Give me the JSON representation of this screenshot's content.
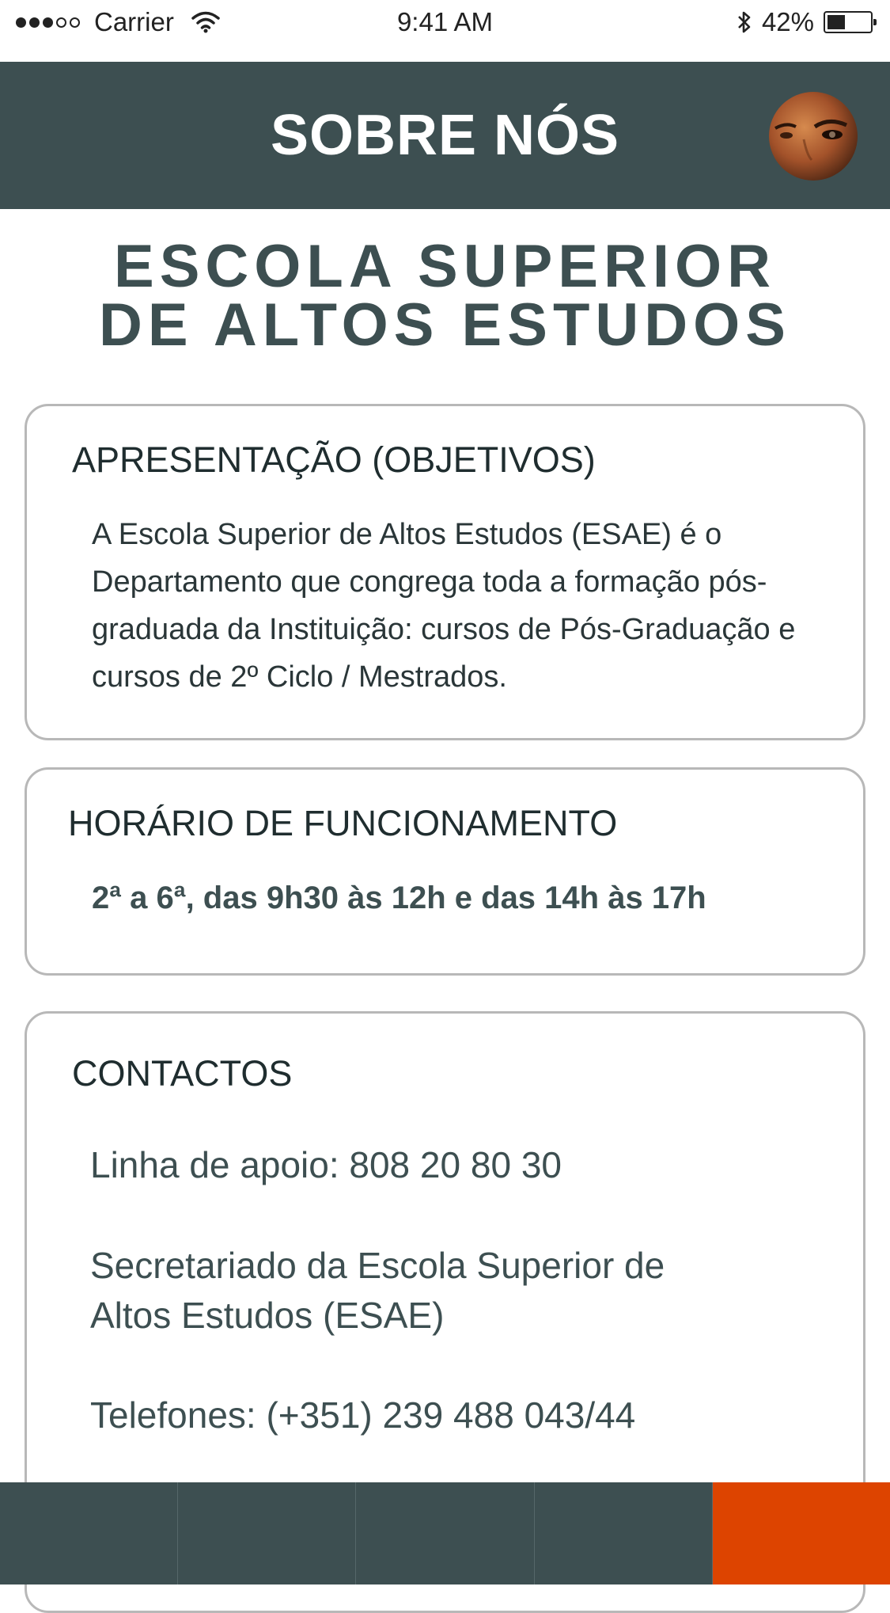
{
  "status_bar": {
    "carrier": "Carrier",
    "time": "9:41 AM",
    "battery_percent": "42%",
    "signal_bars_filled": 3,
    "signal_bars_total": 5,
    "battery_level": 0.42
  },
  "header": {
    "title": "SOBRE NÓS",
    "background_color": "#3d4f51"
  },
  "institution": {
    "title_line_1": "ESCOLA SUPERIOR",
    "title_line_2": "DE ALTOS ESTUDOS"
  },
  "cards": {
    "apresentacao": {
      "title": "APRESENTAÇÃO (OBJETIVOS)",
      "body": "A Escola Superior de Altos Estudos (ESAE) é o Departamento que congrega toda a formação pós-graduada da Instituição: cursos de Pós-Graduação e cursos de 2º Ciclo / Mestrados."
    },
    "horario": {
      "title": "HORÁRIO DE FUNCIONAMENTO",
      "body": "2ª a 6ª, das 9h30 às 12h e das 14h às 17h"
    },
    "contactos": {
      "title": "CONTACTOS",
      "linha_apoio": "Linha de apoio: 808 20 80 30",
      "secretariado_line_1": "Secretariado da Escola Superior de",
      "secretariado_line_2": "Altos Estudos (ESAE)",
      "telefones": "Telefones: (+351) 239 488 043/44"
    }
  },
  "tab_bar": {
    "tab_count": 5,
    "active_index": 4,
    "colors": {
      "background": "#3d4f51",
      "active": "#dd4400"
    }
  }
}
